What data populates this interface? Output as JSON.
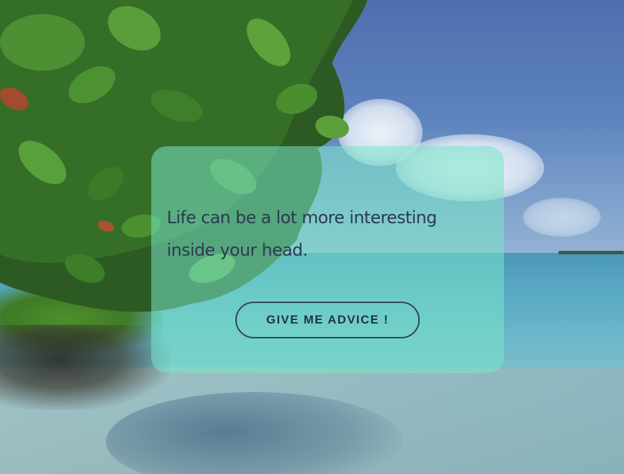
{
  "card": {
    "quote": "Life can be a lot more interesting inside your head.",
    "button_label": "GIVE ME ADVICE !"
  },
  "colors": {
    "card_background": "#78e6c8",
    "quote_text": "#2a3b50",
    "button_border": "#2e4657"
  }
}
